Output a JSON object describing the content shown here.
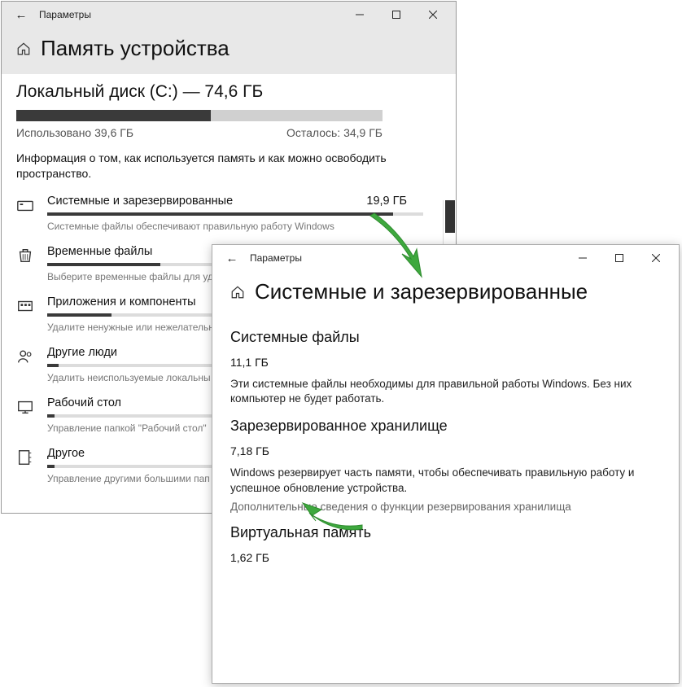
{
  "back": {
    "titlebar": {
      "appname": "Параметры"
    },
    "page_title": "Память устройства",
    "disk_heading": "Локальный диск (C:) — 74,6 ГБ",
    "used_label": "Использовано 39,6 ГБ",
    "free_label": "Осталось: 34,9 ГБ",
    "info": "Информация о том, как используется память и как можно освободить пространство.",
    "categories": [
      {
        "name": "Системные и зарезервированные",
        "size": "19,9 ГБ",
        "desc": "Системные файлы обеспечивают правильную работу Windows",
        "fill": 92
      },
      {
        "name": "Временные файлы",
        "size": "",
        "desc": "Выберите временные файлы для уд",
        "fill": 30
      },
      {
        "name": "Приложения и компоненты",
        "size": "",
        "desc": "Удалите ненужные или нежелательн",
        "fill": 17
      },
      {
        "name": "Другие люди",
        "size": "",
        "desc": "Удалить неиспользуемые локальны",
        "fill": 3
      },
      {
        "name": "Рабочий стол",
        "size": "",
        "desc": "Управление папкой \"Рабочий стол\"",
        "fill": 2
      },
      {
        "name": "Другое",
        "size": "",
        "desc": "Управление другими большими пап",
        "fill": 2
      }
    ]
  },
  "front": {
    "titlebar": {
      "appname": "Параметры"
    },
    "page_title": "Системные и зарезервированные",
    "sections": [
      {
        "title": "Системные файлы",
        "value": "11,1 ГБ",
        "desc": "Эти системные файлы необходимы для правильной работы Windows. Без них компьютер не будет работать.",
        "link": ""
      },
      {
        "title": "Зарезервированное хранилище",
        "value": "7,18 ГБ",
        "desc": "Windows резервирует часть памяти, чтобы обеспечивать правильную работу и успешное обновление устройства.",
        "link": "Дополнительные сведения о функции резервирования хранилища"
      },
      {
        "title": "Виртуальная память",
        "value": "1,62 ГБ",
        "desc": "",
        "link": ""
      }
    ]
  }
}
